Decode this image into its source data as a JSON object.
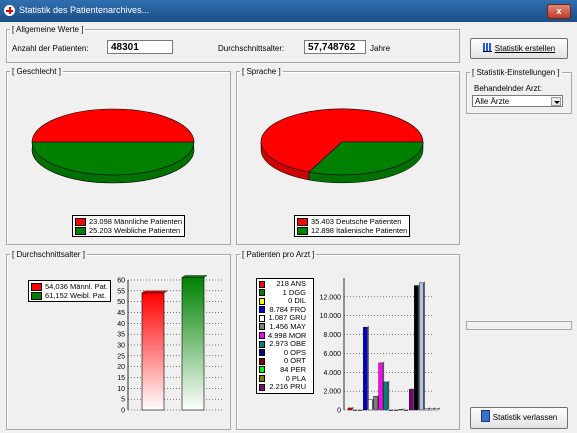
{
  "window": {
    "title": "Statistik des Patientenarchives...",
    "close_label": "x"
  },
  "general": {
    "legend": "[ Allgemeine Werte ]",
    "count_label": "Anzahl der Patienten:",
    "count_value": "48301",
    "avg_label": "Durchschnittsalter:",
    "avg_value": "57,748762",
    "avg_unit": "Jahre"
  },
  "gender": {
    "legend": "[ Geschlecht ]",
    "items": [
      {
        "label": "23.098 Männliche Patienten",
        "value": 23098,
        "color": "#ff0000"
      },
      {
        "label": "25.203 Weibliche Patienten",
        "value": 25203,
        "color": "#008000"
      }
    ]
  },
  "language": {
    "legend": "[ Sprache ]",
    "items": [
      {
        "label": "35.403 Deutsche Patienten",
        "value": 35403,
        "color": "#ff0000"
      },
      {
        "label": "12.898 Italienische Patienten",
        "value": 12898,
        "color": "#008000"
      }
    ]
  },
  "avgage": {
    "legend": "[ Durchschnittsalter ]",
    "items": [
      {
        "label": "54,036 Männl. Pat.",
        "value": 54.036,
        "color": "#ff0000"
      },
      {
        "label": "61,152 Weibl. Pat.",
        "value": 61.152,
        "color": "#008000"
      }
    ],
    "ticks": [
      "60",
      "55",
      "50",
      "45",
      "40",
      "35",
      "30",
      "25",
      "20",
      "15",
      "10",
      "5",
      "0"
    ]
  },
  "doctors": {
    "legend": "[ Patienten pro Arzt ]",
    "items": [
      {
        "label": "218 ANS",
        "value": 218,
        "color": "#ff0000"
      },
      {
        "label": "1 DGG",
        "value": 1,
        "color": "#008000"
      },
      {
        "label": "0 DIL",
        "value": 0,
        "color": "#ffff00"
      },
      {
        "label": "8.784 FRO",
        "value": 8784,
        "color": "#0000cc"
      },
      {
        "label": "1.087 GRU",
        "value": 1087,
        "color": "#ffffff"
      },
      {
        "label": "1.456 MAY",
        "value": 1456,
        "color": "#808080"
      },
      {
        "label": "4.998 MOR",
        "value": 4998,
        "color": "#ff00ff"
      },
      {
        "label": "2.973 OBE",
        "value": 2973,
        "color": "#008080"
      },
      {
        "label": "0 OPS",
        "value": 0,
        "color": "#000080"
      },
      {
        "label": "0 ORT",
        "value": 0,
        "color": "#800000"
      },
      {
        "label": "84 PER",
        "value": 84,
        "color": "#00ff00"
      },
      {
        "label": "0 PLA",
        "value": 0,
        "color": "#808000"
      },
      {
        "label": "2.216 PRU",
        "value": 2216,
        "color": "#800080"
      }
    ],
    "ticks": [
      "12.000",
      "10.000",
      "8.000",
      "6.000",
      "4.000",
      "2.000",
      "0"
    ],
    "tail_bars": [
      {
        "value": 13200,
        "color": "#000000"
      },
      {
        "value": 13500,
        "color": "#b0c4de"
      },
      {
        "value": 150,
        "color": "#ffffff"
      },
      {
        "value": 150,
        "color": "#ffffff"
      },
      {
        "value": 150,
        "color": "#ffffff"
      }
    ]
  },
  "sidebar": {
    "create_button": "Statistik erstellen",
    "settings_legend": "[ Statistik-Einstellungen ]",
    "doctor_label": "Behandelnder Arzt:",
    "doctor_selected": "Alle Ärzte",
    "leave_button": "Statistik verlassen"
  },
  "chart_data": [
    {
      "type": "pie",
      "categories": [
        "Männliche Patienten",
        "Weibliche Patienten"
      ],
      "values": [
        23098,
        25203
      ]
    },
    {
      "type": "pie",
      "categories": [
        "Deutsche Patienten",
        "Italienische Patienten"
      ],
      "values": [
        35403,
        12898
      ]
    },
    {
      "type": "bar",
      "categories": [
        "Männl. Pat.",
        "Weibl. Pat."
      ],
      "values": [
        54.036,
        61.152
      ],
      "ylim": [
        0,
        60
      ]
    },
    {
      "type": "bar",
      "categories": [
        "ANS",
        "DGG",
        "DIL",
        "FRO",
        "GRU",
        "MAY",
        "MOR",
        "OBE",
        "OPS",
        "ORT",
        "PER",
        "PLA",
        "PRU"
      ],
      "values": [
        218,
        1,
        0,
        8784,
        1087,
        1456,
        4998,
        2973,
        0,
        0,
        84,
        0,
        2216
      ],
      "ylim": [
        0,
        12000
      ]
    }
  ]
}
